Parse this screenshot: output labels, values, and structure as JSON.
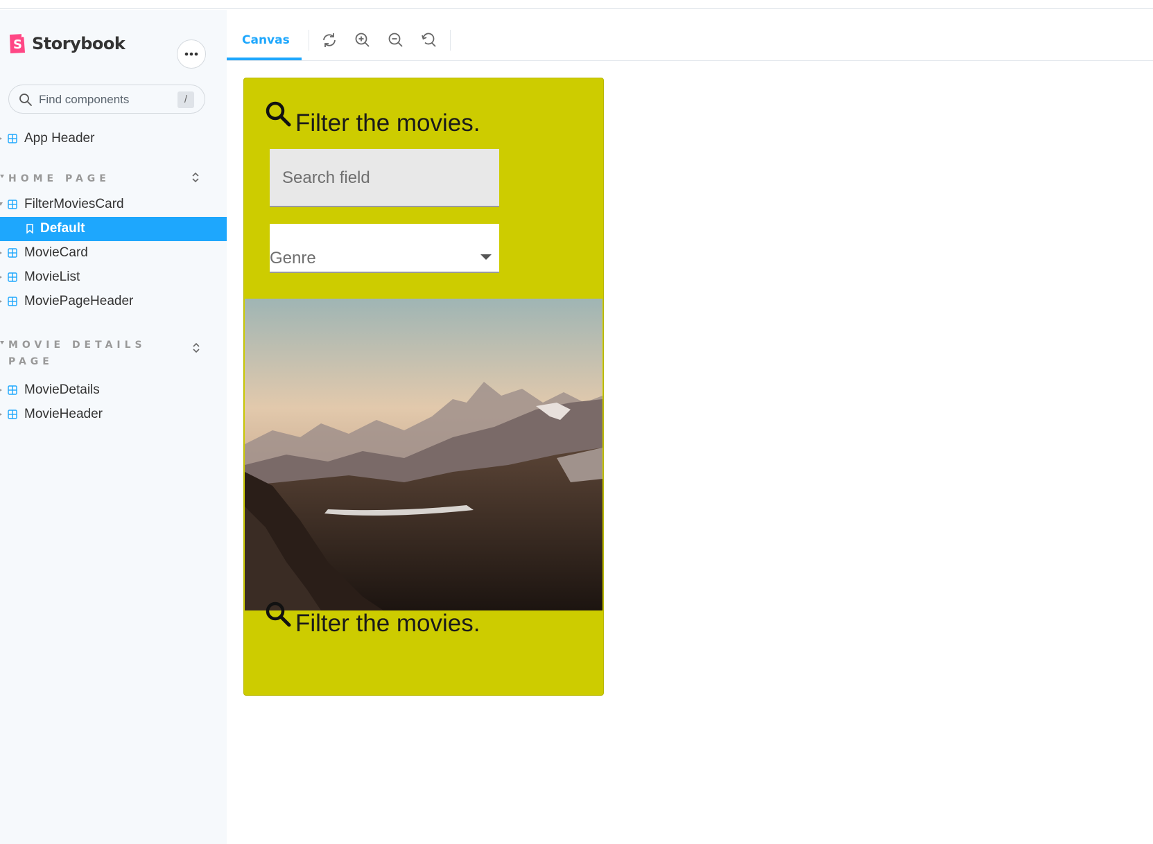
{
  "app": {
    "name": "Storybook"
  },
  "sidebar": {
    "search_placeholder": "Find components",
    "search_shortcut": "/",
    "items": [
      {
        "label": "App Header"
      }
    ],
    "sections": [
      {
        "title": "HOME PAGE",
        "items": [
          {
            "label": "FilterMoviesCard"
          },
          {
            "label": "Default"
          },
          {
            "label": "MovieCard"
          },
          {
            "label": "MovieList"
          },
          {
            "label": "MoviePageHeader"
          }
        ]
      },
      {
        "title_line1": "MOVIE DETAILS",
        "title_line2": "PAGE",
        "items": [
          {
            "label": "MovieDetails"
          },
          {
            "label": "MovieHeader"
          }
        ]
      }
    ]
  },
  "toolbar": {
    "tab_canvas": "Canvas",
    "tools": [
      "reload-icon",
      "zoom-in-icon",
      "zoom-out-icon",
      "zoom-reset-icon"
    ]
  },
  "card": {
    "heading": "Filter the movies.",
    "search_placeholder": "Search field",
    "genre_label": "Genre",
    "footer_heading": "Filter the movies."
  },
  "colors": {
    "accent": "#1ea7fd",
    "card_bg": "#cdcc00",
    "brand_pink": "#ff4785"
  }
}
